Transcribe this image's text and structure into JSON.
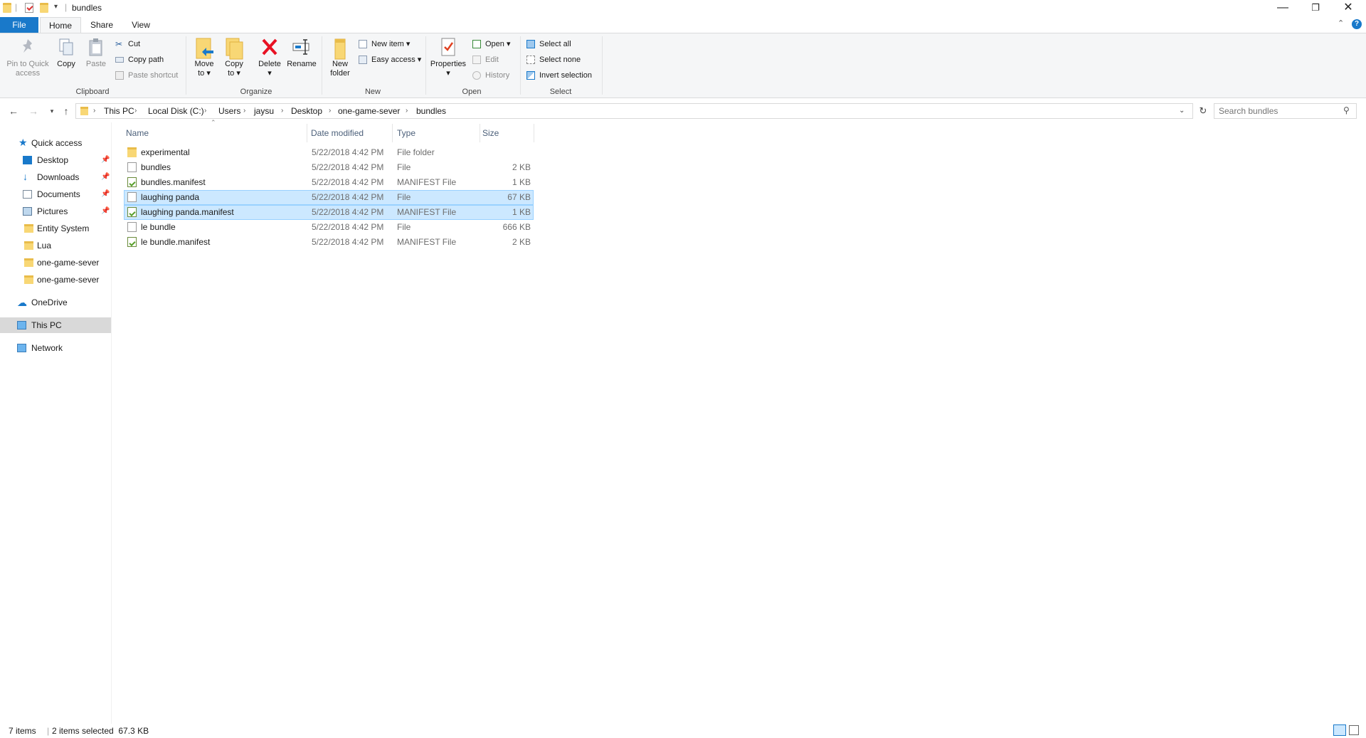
{
  "window": {
    "title": "bundles",
    "controls": {
      "minimize": "—",
      "restore": "❐",
      "close": "✕"
    }
  },
  "tabs": {
    "file": "File",
    "home": "Home",
    "share": "Share",
    "view": "View"
  },
  "ribbon": {
    "clipboard": {
      "label": "Clipboard",
      "pin_line1": "Pin to Quick",
      "pin_line2": "access",
      "copy": "Copy",
      "paste": "Paste",
      "cut": "Cut",
      "copy_path": "Copy path",
      "paste_shortcut": "Paste shortcut"
    },
    "organize": {
      "label": "Organize",
      "move_line1": "Move",
      "move_line2": "to ▾",
      "copyto_line1": "Copy",
      "copyto_line2": "to ▾",
      "delete": "Delete",
      "delete_arrow": "▾",
      "rename": "Rename"
    },
    "new": {
      "label": "New",
      "folder_line1": "New",
      "folder_line2": "folder",
      "new_item": "New item ▾",
      "easy_access": "Easy access ▾"
    },
    "open": {
      "label": "Open",
      "properties": "Properties",
      "properties_arrow": "▾",
      "open": "Open ▾",
      "edit": "Edit",
      "history": "History"
    },
    "select": {
      "label": "Select",
      "select_all": "Select all",
      "select_none": "Select none",
      "invert": "Invert selection"
    }
  },
  "address": {
    "breadcrumbs": [
      "This PC",
      "Local Disk (C:)",
      "Users",
      "jaysu",
      "Desktop",
      "one-game-sever",
      "bundles"
    ],
    "search_placeholder": "Search bundles"
  },
  "nav": {
    "quick_access": "Quick access",
    "pinned": [
      "Desktop",
      "Downloads",
      "Documents",
      "Pictures"
    ],
    "folders": [
      "Entity System",
      "Lua",
      "one-game-sever",
      "one-game-sever"
    ],
    "onedrive": "OneDrive",
    "this_pc": "This PC",
    "network": "Network"
  },
  "columns": {
    "name": "Name",
    "date": "Date modified",
    "type": "Type",
    "size": "Size"
  },
  "files": [
    {
      "name": "experimental",
      "date": "5/22/2018 4:42 PM",
      "type": "File folder",
      "size": "",
      "icon": "folder-icon",
      "selected": false
    },
    {
      "name": "bundles",
      "date": "5/22/2018 4:42 PM",
      "type": "File",
      "size": "2 KB",
      "icon": "file-icon",
      "selected": false
    },
    {
      "name": "bundles.manifest",
      "date": "5/22/2018 4:42 PM",
      "type": "MANIFEST File",
      "size": "1 KB",
      "icon": "manifest-file-icon",
      "selected": false
    },
    {
      "name": "laughing panda",
      "date": "5/22/2018 4:42 PM",
      "type": "File",
      "size": "67 KB",
      "icon": "file-icon",
      "selected": true
    },
    {
      "name": "laughing panda.manifest",
      "date": "5/22/2018 4:42 PM",
      "type": "MANIFEST File",
      "size": "1 KB",
      "icon": "manifest-file-icon",
      "selected": true
    },
    {
      "name": "le bundle",
      "date": "5/22/2018 4:42 PM",
      "type": "File",
      "size": "666 KB",
      "icon": "file-icon",
      "selected": false
    },
    {
      "name": "le bundle.manifest",
      "date": "5/22/2018 4:42 PM",
      "type": "MANIFEST File",
      "size": "2 KB",
      "icon": "manifest-file-icon",
      "selected": false
    }
  ],
  "status": {
    "count": "7 items",
    "selection": "2 items selected  67.3 KB"
  },
  "colors": {
    "accent": "#1979ca",
    "selection": "#cce8ff",
    "selection_border": "#99d1ff",
    "delete_red": "#e81123"
  }
}
